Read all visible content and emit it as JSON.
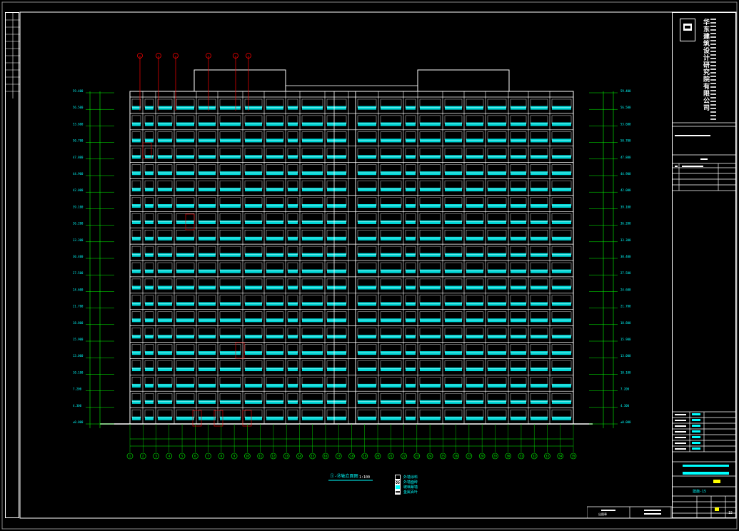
{
  "drawing": {
    "sheet_title": "①-⑱轴立面图",
    "scale": "1:100",
    "company_vertical": "华东建筑设计研究院有限公司",
    "stamp_label": "出图章",
    "legend": [
      "外墙涂料",
      "外墙面砖",
      "玻璃幕墙",
      "金属百叶"
    ],
    "axis_labels": [
      "1",
      "2",
      "3",
      "4",
      "5",
      "6",
      "7",
      "8",
      "9",
      "10",
      "11",
      "12",
      "13",
      "14",
      "15",
      "16",
      "17",
      "18",
      "19",
      "20",
      "21",
      "22",
      "23",
      "24",
      "25",
      "26",
      "27",
      "28",
      "29",
      "30",
      "31",
      "32",
      "33",
      "34",
      "35"
    ],
    "level_marks": [
      "59.400",
      "56.500",
      "53.600",
      "50.700",
      "47.800",
      "44.900",
      "42.000",
      "39.100",
      "36.200",
      "33.300",
      "30.400",
      "27.500",
      "24.600",
      "21.700",
      "18.800",
      "15.900",
      "13.000",
      "10.100",
      "7.200",
      "4.300",
      "±0.000"
    ],
    "drawing_no": "建施-15",
    "sheet_no": "15"
  },
  "colors": {
    "background": "#000000",
    "line": "#ffffff",
    "window": "#00ffff",
    "dim": "#00ff00",
    "accent": "#ff0000",
    "highlight": "#ffff00"
  }
}
